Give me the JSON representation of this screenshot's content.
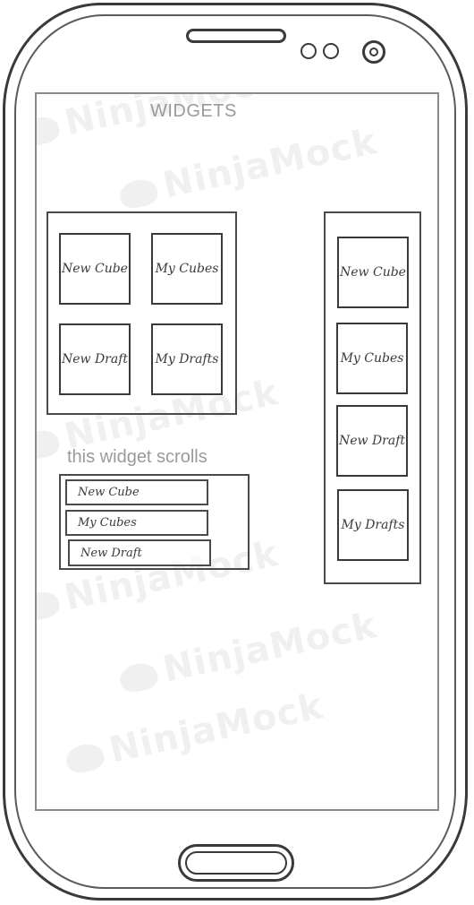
{
  "screen": {
    "title": "WIDGETS",
    "watermark": "NinjaMock"
  },
  "grid_widget": {
    "tiles": [
      {
        "label": "New Cube"
      },
      {
        "label": "My Cubes"
      },
      {
        "label": "New Draft"
      },
      {
        "label": "My Drafts"
      }
    ]
  },
  "scroll_widget": {
    "hint": "this widget scrolls",
    "items": [
      {
        "label": "New Cube"
      },
      {
        "label": "My Cubes"
      },
      {
        "label": "New Draft"
      }
    ]
  },
  "column_widget": {
    "tiles": [
      {
        "label": "New Cube"
      },
      {
        "label": "My Cubes"
      },
      {
        "label": "New Draft"
      },
      {
        "label": "My Drafts"
      }
    ]
  }
}
